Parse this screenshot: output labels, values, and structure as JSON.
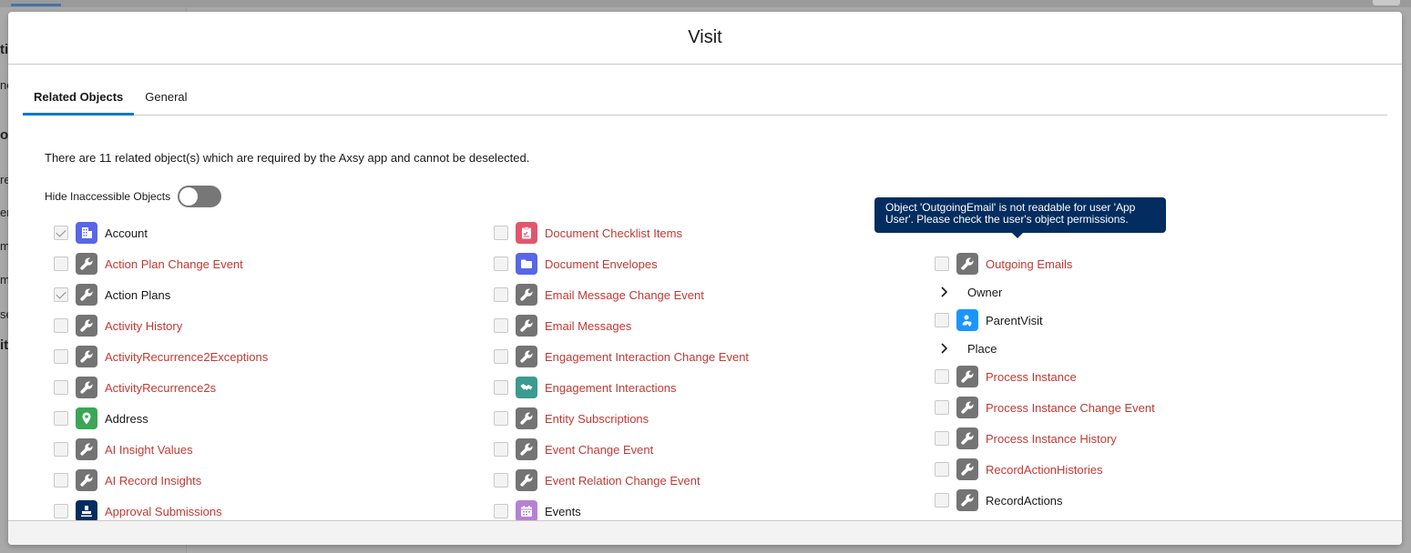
{
  "background": {
    "left_fragments": [
      "ti",
      "ne",
      "o",
      "re",
      "en",
      "m",
      "m",
      "se",
      "it"
    ]
  },
  "modal": {
    "title": "Visit",
    "tabs": [
      {
        "label": "Related Objects",
        "active": true
      },
      {
        "label": "General",
        "active": false
      }
    ],
    "info_text": "There are 11 related object(s) which are required by the Axsy app and cannot be deselected.",
    "toggle_label": "Hide Inaccessible Objects",
    "toggle_on": false
  },
  "tooltip": {
    "text": "Object 'OutgoingEmail' is not readable for user 'App User'. Please check the user's object permissions."
  },
  "columns": {
    "col1": [
      {
        "label": "Account",
        "checked": true,
        "accessible": true,
        "icon": "account-icon",
        "color": "#5867e8"
      },
      {
        "label": "Action Plan Change Event",
        "checked": false,
        "accessible": false,
        "icon": "wrench-icon",
        "color": "#747474"
      },
      {
        "label": "Action Plans",
        "checked": true,
        "accessible": true,
        "icon": "wrench-icon",
        "color": "#747474"
      },
      {
        "label": "Activity History",
        "checked": false,
        "accessible": false,
        "icon": "wrench-icon",
        "color": "#747474"
      },
      {
        "label": "ActivityRecurrence2Exceptions",
        "checked": false,
        "accessible": false,
        "icon": "wrench-icon",
        "color": "#747474"
      },
      {
        "label": "ActivityRecurrence2s",
        "checked": false,
        "accessible": false,
        "icon": "wrench-icon",
        "color": "#747474"
      },
      {
        "label": "Address",
        "checked": false,
        "accessible": true,
        "icon": "location-pin-icon",
        "color": "#3ba755"
      },
      {
        "label": "AI Insight Values",
        "checked": false,
        "accessible": false,
        "icon": "wrench-icon",
        "color": "#747474"
      },
      {
        "label": "AI Record Insights",
        "checked": false,
        "accessible": false,
        "icon": "wrench-icon",
        "color": "#747474"
      },
      {
        "label": "Approval Submissions",
        "checked": false,
        "accessible": false,
        "icon": "stamp-icon",
        "color": "#032d60"
      }
    ],
    "col2": [
      {
        "label": "Document Checklist Items",
        "checked": false,
        "accessible": false,
        "icon": "checklist-icon",
        "color": "#e3566d"
      },
      {
        "label": "Document Envelopes",
        "checked": false,
        "accessible": false,
        "icon": "folder-icon",
        "color": "#5867e8"
      },
      {
        "label": "Email Message Change Event",
        "checked": false,
        "accessible": false,
        "icon": "wrench-icon",
        "color": "#747474"
      },
      {
        "label": "Email Messages",
        "checked": false,
        "accessible": false,
        "icon": "wrench-icon",
        "color": "#747474"
      },
      {
        "label": "Engagement Interaction Change Event",
        "checked": false,
        "accessible": false,
        "icon": "wrench-icon",
        "color": "#747474"
      },
      {
        "label": "Engagement Interactions",
        "checked": false,
        "accessible": false,
        "icon": "handshake-icon",
        "color": "#3a9b8e"
      },
      {
        "label": "Entity Subscriptions",
        "checked": false,
        "accessible": false,
        "icon": "wrench-icon",
        "color": "#747474"
      },
      {
        "label": "Event Change Event",
        "checked": false,
        "accessible": false,
        "icon": "wrench-icon",
        "color": "#747474"
      },
      {
        "label": "Event Relation Change Event",
        "checked": false,
        "accessible": false,
        "icon": "wrench-icon",
        "color": "#747474"
      },
      {
        "label": "Events",
        "checked": false,
        "accessible": true,
        "icon": "calendar-icon",
        "color": "#b781d3"
      }
    ],
    "col3": [
      {
        "type": "item",
        "label": "Outgoing Emails",
        "checked": false,
        "accessible": false,
        "icon": "wrench-icon",
        "color": "#747474"
      },
      {
        "type": "expand",
        "label": "Owner"
      },
      {
        "type": "item",
        "label": "ParentVisit",
        "checked": false,
        "accessible": true,
        "icon": "visit-icon",
        "color": "#1b96ff"
      },
      {
        "type": "expand",
        "label": "Place"
      },
      {
        "type": "item",
        "label": "Process Instance",
        "checked": false,
        "accessible": false,
        "icon": "wrench-icon",
        "color": "#747474"
      },
      {
        "type": "item",
        "label": "Process Instance Change Event",
        "checked": false,
        "accessible": false,
        "icon": "wrench-icon",
        "color": "#747474"
      },
      {
        "type": "item",
        "label": "Process Instance History",
        "checked": false,
        "accessible": false,
        "icon": "wrench-icon",
        "color": "#747474"
      },
      {
        "type": "item",
        "label": "RecordActionHistories",
        "checked": false,
        "accessible": false,
        "icon": "wrench-icon",
        "color": "#747474"
      },
      {
        "type": "item",
        "label": "RecordActions",
        "checked": false,
        "accessible": true,
        "icon": "wrench-icon",
        "color": "#747474"
      }
    ]
  },
  "colors": {
    "accent": "#0176d3",
    "inaccessible_text": "#c23934",
    "tooltip_bg": "#032d60"
  }
}
